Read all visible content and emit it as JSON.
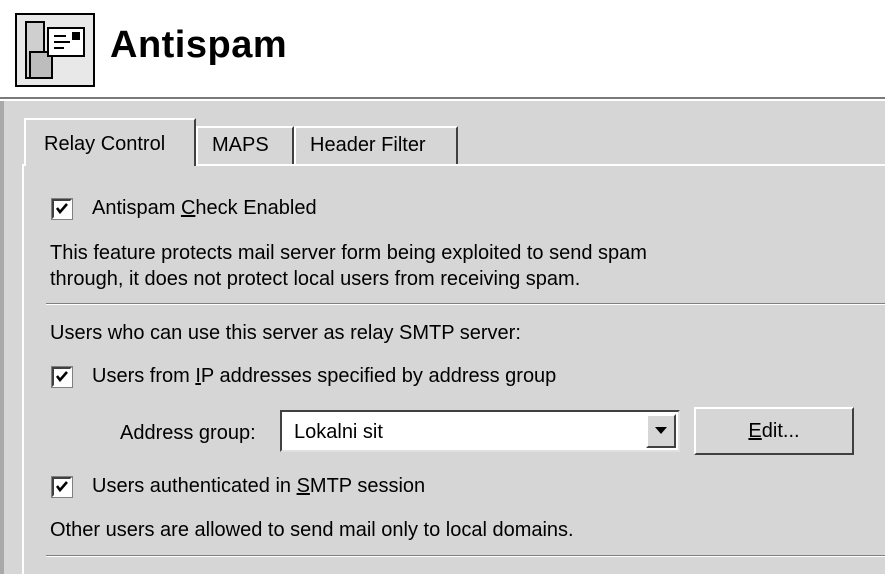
{
  "header": {
    "title": "Antispam",
    "icon": "mail-server-icon"
  },
  "tabs": [
    {
      "label": "Relay Control",
      "active": true
    },
    {
      "label": "MAPS",
      "active": false
    },
    {
      "label": "Header Filter",
      "active": false
    }
  ],
  "relay_control": {
    "antispam_check": {
      "label_pre": "Antispam ",
      "label_accel": "C",
      "label_post": "heck Enabled",
      "checked": true
    },
    "description_line1": "This feature protects mail server form being exploited to send spam",
    "description_line2": "through, it does not protect local users from receiving spam.",
    "relay_heading": "Users who can use this server as relay SMTP server:",
    "ip_users": {
      "label_pre": "Users from ",
      "label_accel": "I",
      "label_post": "P addresses specified by address group",
      "checked": true
    },
    "address_group": {
      "label": "Address group:",
      "value": "Lokalni sit",
      "edit_accel": "E",
      "edit_rest": "dit..."
    },
    "smtp_auth": {
      "label_pre": "Users authenticated in ",
      "label_accel": "S",
      "label_post": "MTP session",
      "checked": true
    },
    "footer_note": "Other users are allowed to send mail only to local domains."
  }
}
